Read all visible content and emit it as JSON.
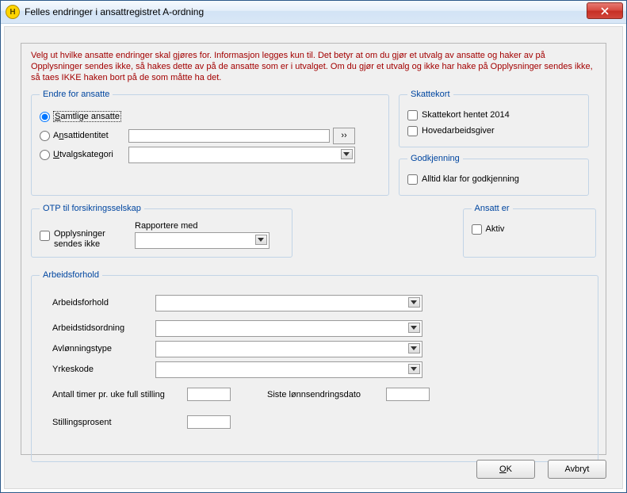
{
  "window": {
    "title": "Felles endringer i ansattregistret A-ordning"
  },
  "warning": "Velg ut hvilke ansatte endringer skal gjøres for. Informasjon legges kun til. Det betyr at om du gjør et utvalg av ansatte og haker av på Opplysninger sendes ikke, så hakes dette av på de ansatte som er i utvalget. Om du gjør et utvalg og ikke har hake på Opplysninger sendes ikke, så taes IKKE haken bort på de som måtte ha det.",
  "endre": {
    "legend": "Endre for ansatte",
    "opt1": "Samtlige ansatte",
    "opt2": "Ansattidentitet",
    "opt3": "Utvalgskategori"
  },
  "skatt": {
    "legend": "Skattekort",
    "opt1": "Skattekort hentet 2014",
    "opt2": "Hovedarbeidsgiver"
  },
  "godk": {
    "legend": "Godkjenning",
    "opt1": "Alltid klar for godkjenning"
  },
  "otp": {
    "legend": "OTP til forsikringsselskap",
    "opt1": "Opplysninger sendes ikke",
    "opt_col2": "Rapportere med"
  },
  "ansatt": {
    "legend": "Ansatt er",
    "opt1": "Aktiv"
  },
  "arbeid": {
    "legend": "Arbeidsforhold",
    "l1": "Arbeidsforhold",
    "l2": "Arbeidstidsordning",
    "l3": "Avlønningstype",
    "l4": "Yrkeskode",
    "pair1a": "Antall timer pr. uke full stilling",
    "pair1b": "Siste lønnsendringsdato",
    "pair2": "Stillingsprosent"
  },
  "footer": {
    "ok": "OK",
    "cancel": "Avbryt"
  }
}
